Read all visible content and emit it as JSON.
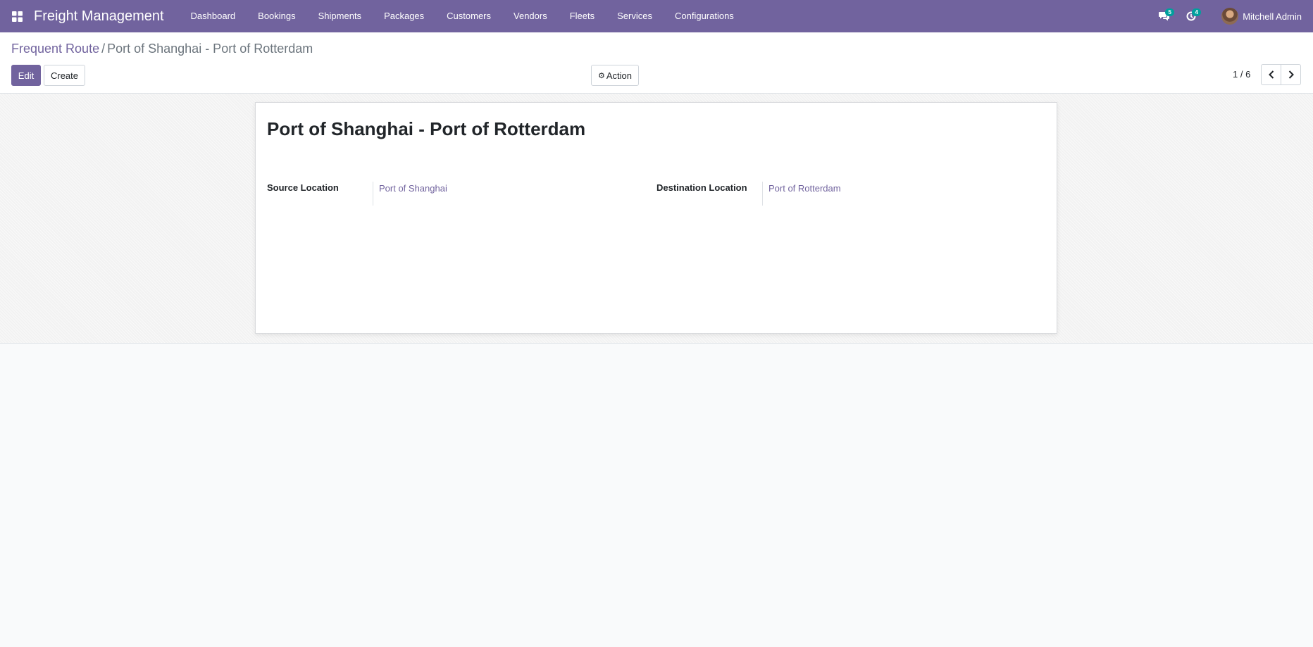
{
  "navbar": {
    "app_title": "Freight Management",
    "menu": [
      "Dashboard",
      "Bookings",
      "Shipments",
      "Packages",
      "Customers",
      "Vendors",
      "Fleets",
      "Services",
      "Configurations"
    ],
    "messages_badge": "5",
    "activities_badge": "4",
    "user_name": "Mitchell Admin",
    "accent_color": "#71639e",
    "badge_color": "#00a09d"
  },
  "breadcrumb": {
    "parent": "Frequent Route",
    "separator": "/",
    "current": "Port of Shanghai - Port of Rotterdam"
  },
  "toolbar": {
    "edit_label": "Edit",
    "create_label": "Create",
    "action_label": "Action",
    "action_icon": "gear-icon"
  },
  "pager": {
    "value": "1 / 6"
  },
  "form": {
    "title": "Port of Shanghai - Port of Rotterdam",
    "source_label": "Source Location",
    "source_value": "Port of Shanghai",
    "destination_label": "Destination Location",
    "destination_value": "Port of Rotterdam"
  }
}
